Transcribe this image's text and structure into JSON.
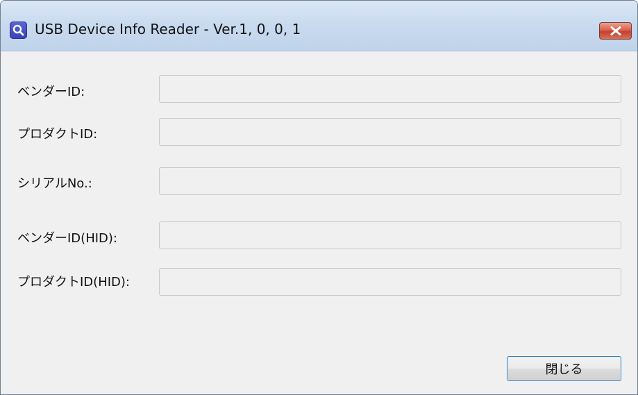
{
  "window": {
    "title": "USB Device Info Reader - Ver.1, 0, 0, 1",
    "app_icon": "magnifier-icon",
    "close_icon": "close-icon"
  },
  "fields": [
    {
      "label": "ベンダーID:",
      "value": "",
      "placeholder": ""
    },
    {
      "label": "プロダクトID:",
      "value": "",
      "placeholder": ""
    },
    {
      "label": "シリアルNo.:",
      "value": "",
      "placeholder": ""
    },
    {
      "label": "ベンダーID(HID):",
      "value": "",
      "placeholder": ""
    },
    {
      "label": "プロダクトID(HID):",
      "value": "",
      "placeholder": ""
    }
  ],
  "buttons": {
    "close_label": "閉じる"
  },
  "colors": {
    "titlebar": "#c9dbef",
    "window_bg": "#f0f0f0",
    "close_button": "#c5412e",
    "focus_border": "#3c7fb1"
  }
}
